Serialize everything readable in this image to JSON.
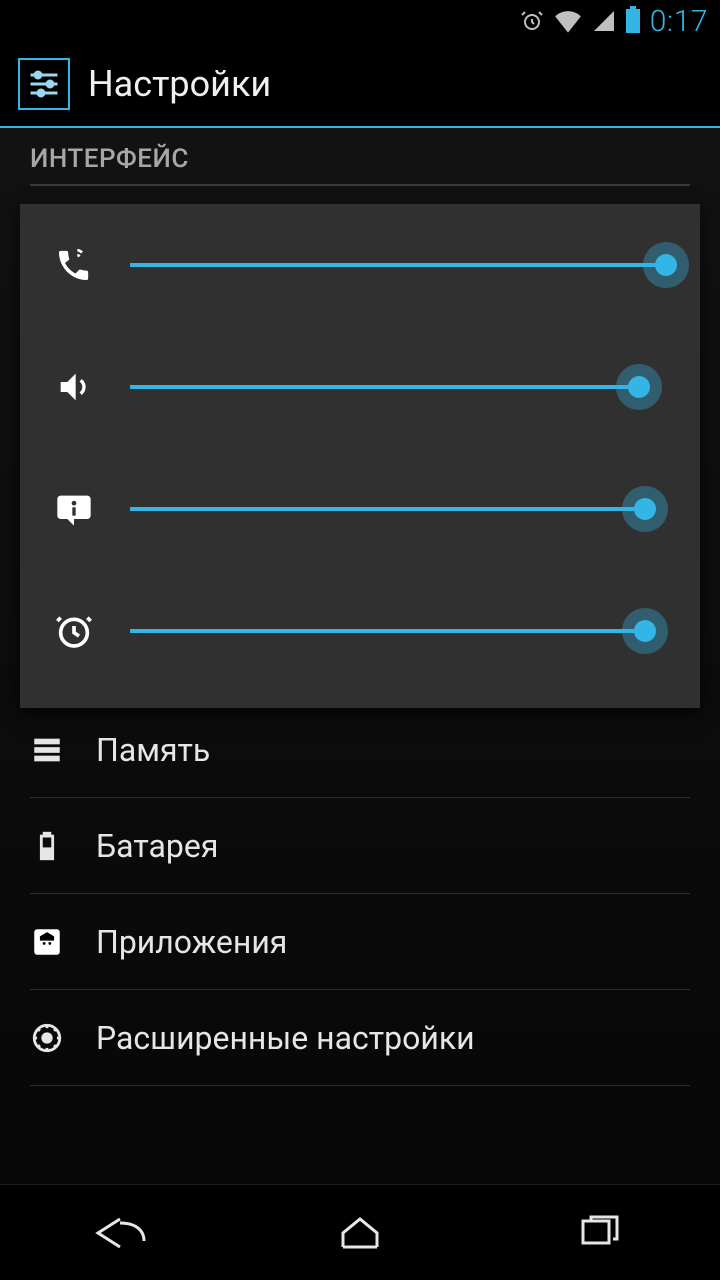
{
  "status": {
    "time": "0:17",
    "icons": [
      "alarm-icon",
      "wifi-icon",
      "signal-icon",
      "battery-icon"
    ]
  },
  "app": {
    "title": "Настройки"
  },
  "section": {
    "header": "ИНТЕРФЕЙС"
  },
  "settings_items": [
    {
      "icon": "storage-icon",
      "label": "Память"
    },
    {
      "icon": "battery-icon",
      "label": "Батарея"
    },
    {
      "icon": "apps-icon",
      "label": "Приложения"
    },
    {
      "icon": "gear-icon",
      "label": "Расширенные настройки"
    }
  ],
  "volume_dialog": {
    "sliders": [
      {
        "icon": "phone-icon",
        "value": 100
      },
      {
        "icon": "speaker-icon",
        "value": 95
      },
      {
        "icon": "notification-icon",
        "value": 96
      },
      {
        "icon": "alarm-icon",
        "value": 96
      }
    ]
  },
  "colors": {
    "accent": "#33b5e5",
    "bg": "#000000",
    "dialog": "#303030"
  }
}
